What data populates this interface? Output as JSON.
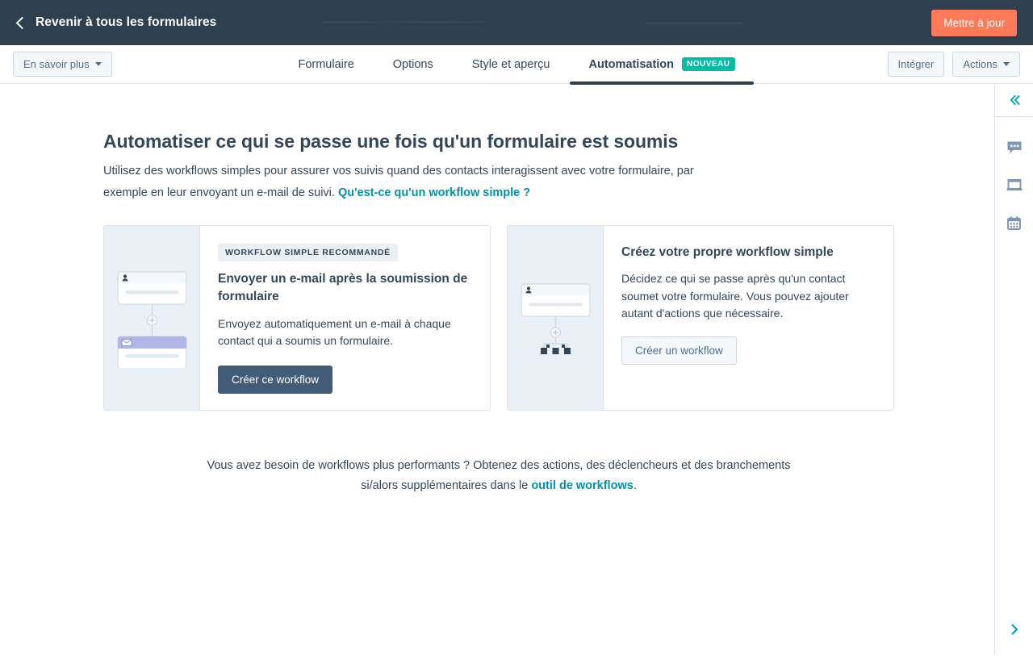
{
  "topbar": {
    "back_label": "Revenir à tous les formulaires",
    "back_icon": "chevron-left-icon",
    "update_button": "Mettre à jour",
    "bg_color": "#2e3f50",
    "update_color": "#ff7a59"
  },
  "tabbar": {
    "learn_more": "En savoir plus",
    "tabs": [
      {
        "label": "Formulaire",
        "active": false
      },
      {
        "label": "Options",
        "active": false
      },
      {
        "label": "Style et aperçu",
        "active": false
      },
      {
        "label": "Automatisation",
        "active": true,
        "badge": "NOUVEAU"
      }
    ],
    "badge_color": "#00bda5",
    "integrate": "Intégrer",
    "actions": "Actions"
  },
  "main": {
    "title": "Automatiser ce qui se passe une fois qu'un formulaire est soumis",
    "subtitle_part1": "Utilisez des workflows simples pour assurer vos suivis quand des contacts interagissent avec votre formulaire, par exemple en leur envoyant un e-mail de suivi.",
    "subtitle_link": "Qu'est-ce qu'un workflow simple ?",
    "link_color": "#0091ae"
  },
  "cards": [
    {
      "badge": "WORKFLOW SIMPLE RECOMMANDÉ",
      "title": "Envoyer un e-mail après la soumission de formulaire",
      "description": "Envoyez automatiquement un e-mail à chaque contact qui a soumis un formulaire.",
      "button": "Créer ce workflow",
      "button_style": "primary",
      "button_color": "#425b76",
      "illustration": "workflow-email-diagram"
    },
    {
      "badge": null,
      "title": "Créez votre propre workflow simple",
      "description": "Décidez ce qui se passe après qu'un contact soumet votre formulaire. Vous pouvez ajouter autant d'actions que nécessaire.",
      "button": "Créer un workflow",
      "button_style": "secondary",
      "button_color": "#f5f8fa",
      "illustration": "workflow-blank-diagram"
    }
  ],
  "footer": {
    "text_part1": "Vous avez besoin de workflows plus performants ? Obtenez des actions, des déclencheurs et des branchements si/alors supplémentaires dans le ",
    "link": "outil de workflows",
    "text_part2": "."
  },
  "rail": {
    "collapse_icon": "chevrons-left-icon",
    "icons": [
      {
        "name": "chat-bubble-icon"
      },
      {
        "name": "meetings-inbox-icon"
      },
      {
        "name": "calendar-icon"
      }
    ],
    "expand_icon": "chevron-right-icon",
    "accent_color": "#00a4bd"
  }
}
